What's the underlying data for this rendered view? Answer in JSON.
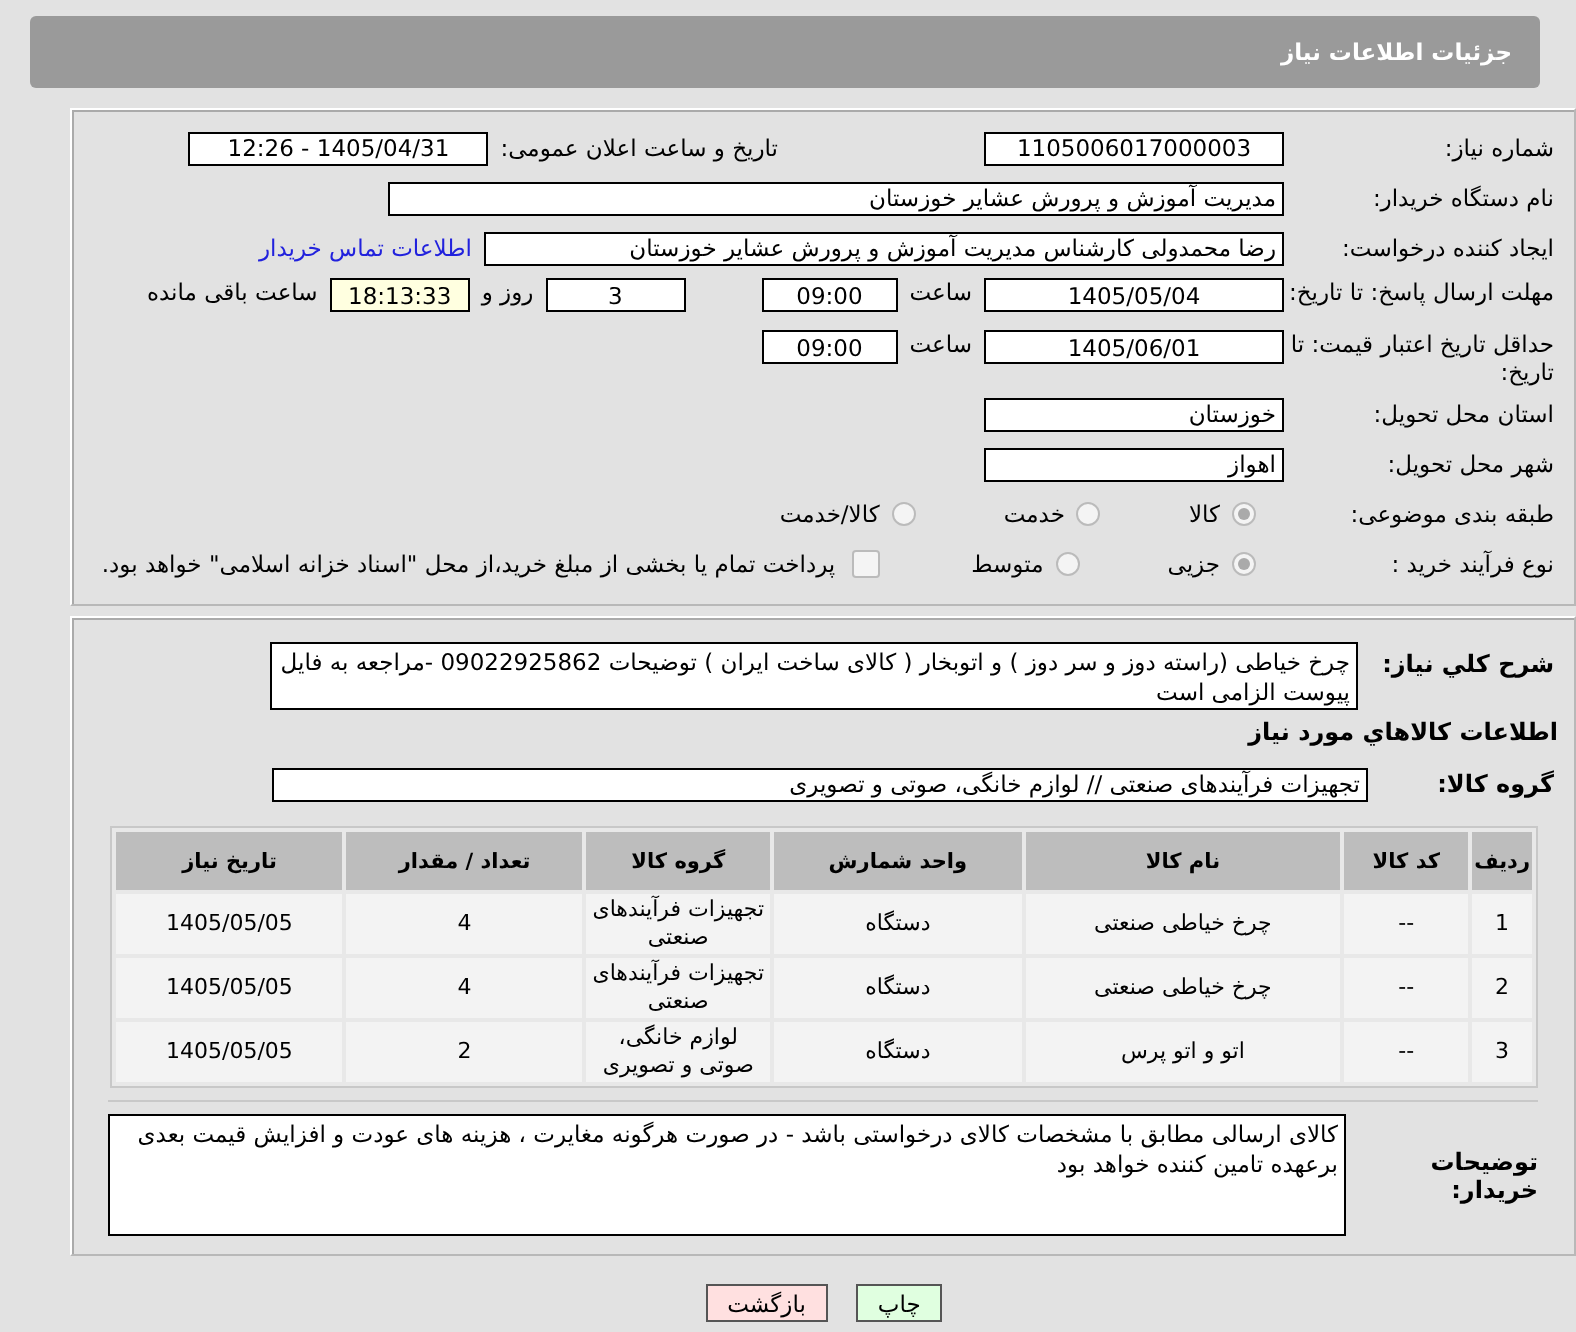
{
  "header": {
    "title": "جزئیات اطلاعات نیاز"
  },
  "need_number": {
    "label": "شماره نیاز:",
    "value": "1105006017000003"
  },
  "announce": {
    "label": "تاریخ و ساعت اعلان عمومی:",
    "value": "1405/04/31 - 12:26"
  },
  "buyer_org": {
    "label": "نام دستگاه خریدار:",
    "value": "مدیریت  آموزش و پرورش عشایر خوزستان"
  },
  "requester": {
    "label": "ایجاد کننده درخواست:",
    "value": "رضا محمدولی کارشناس مدیریت  آموزش و پرورش عشایر خوزستان",
    "link": "اطلاعات تماس خریدار"
  },
  "reply_deadline": {
    "label": "مهلت ارسال پاسخ: تا تاریخ:",
    "date": "1405/05/04",
    "time_label": "ساعت",
    "time": "09:00",
    "days": "3",
    "days_label": "روز و",
    "remaining": "18:13:33",
    "remaining_label": "ساعت باقی مانده"
  },
  "price_validity": {
    "label": "حداقل تاریخ اعتبار قیمت: تا تاریخ:",
    "date": "1405/06/01",
    "time_label": "ساعت",
    "time": "09:00"
  },
  "province": {
    "label": "استان محل تحویل:",
    "value": "خوزستان"
  },
  "city": {
    "label": "شهر محل تحویل:",
    "value": "اهواز"
  },
  "category": {
    "label": "طبقه بندی موضوعی:",
    "options": [
      {
        "label": "کالا",
        "selected": true
      },
      {
        "label": "خدمت",
        "selected": false
      },
      {
        "label": "کالا/خدمت",
        "selected": false
      }
    ]
  },
  "process": {
    "label": "نوع فرآیند خرید :",
    "options": [
      {
        "label": "جزیی",
        "selected": true
      },
      {
        "label": "متوسط",
        "selected": false
      }
    ],
    "treasury": {
      "label": "پرداخت تمام یا بخشی از مبلغ خرید،از محل \"اسناد خزانه اسلامی\" خواهد بود.",
      "checked": false
    }
  },
  "description": {
    "label": "شرح کلي نیاز:",
    "value": "چرخ خیاطی (راسته دوز و سر دوز ) و اتوبخار ( کالای ساخت ایران ) توضیحات  09022925862   -مراجعه به فایل پیوست الزامی است"
  },
  "goods_heading": "اطلاعات کالاهاي مورد نیاز",
  "goods_group": {
    "label": "گروه کالا:",
    "value": "تجهیزات فرآیندهای صنعتی // لوازم خانگی، صوتی و تصویری"
  },
  "table": {
    "columns": [
      "ردیف",
      "کد کالا",
      "نام کالا",
      "واحد شمارش",
      "گروه کالا",
      "تعداد / مقدار",
      "تاریخ نیاز"
    ],
    "rows": [
      [
        "1",
        "--",
        "چرخ خیاطی صنعتی",
        "دستگاه",
        "تجهیزات فرآیندهای صنعتی",
        "4",
        "1405/05/05"
      ],
      [
        "2",
        "--",
        "چرخ خیاطی صنعتی",
        "دستگاه",
        "تجهیزات فرآیندهای صنعتی",
        "4",
        "1405/05/05"
      ],
      [
        "3",
        "--",
        "اتو و اتو پرس",
        "دستگاه",
        "لوازم خانگی، صوتی و تصویری",
        "2",
        "1405/05/05"
      ]
    ]
  },
  "buyer_notes": {
    "label": "توضیحات خریدار:",
    "value": "کالای ارسالی مطابق با مشخصات کالای درخواستی باشد - در صورت هرگونه مغایرت ، هزینه های عودت و  افزایش قیمت بعدی برعهده تامین کننده خواهد بود"
  },
  "buttons": [
    {
      "label": "چاپ",
      "kind": "print"
    },
    {
      "label": "بازگشت",
      "kind": "back"
    }
  ]
}
